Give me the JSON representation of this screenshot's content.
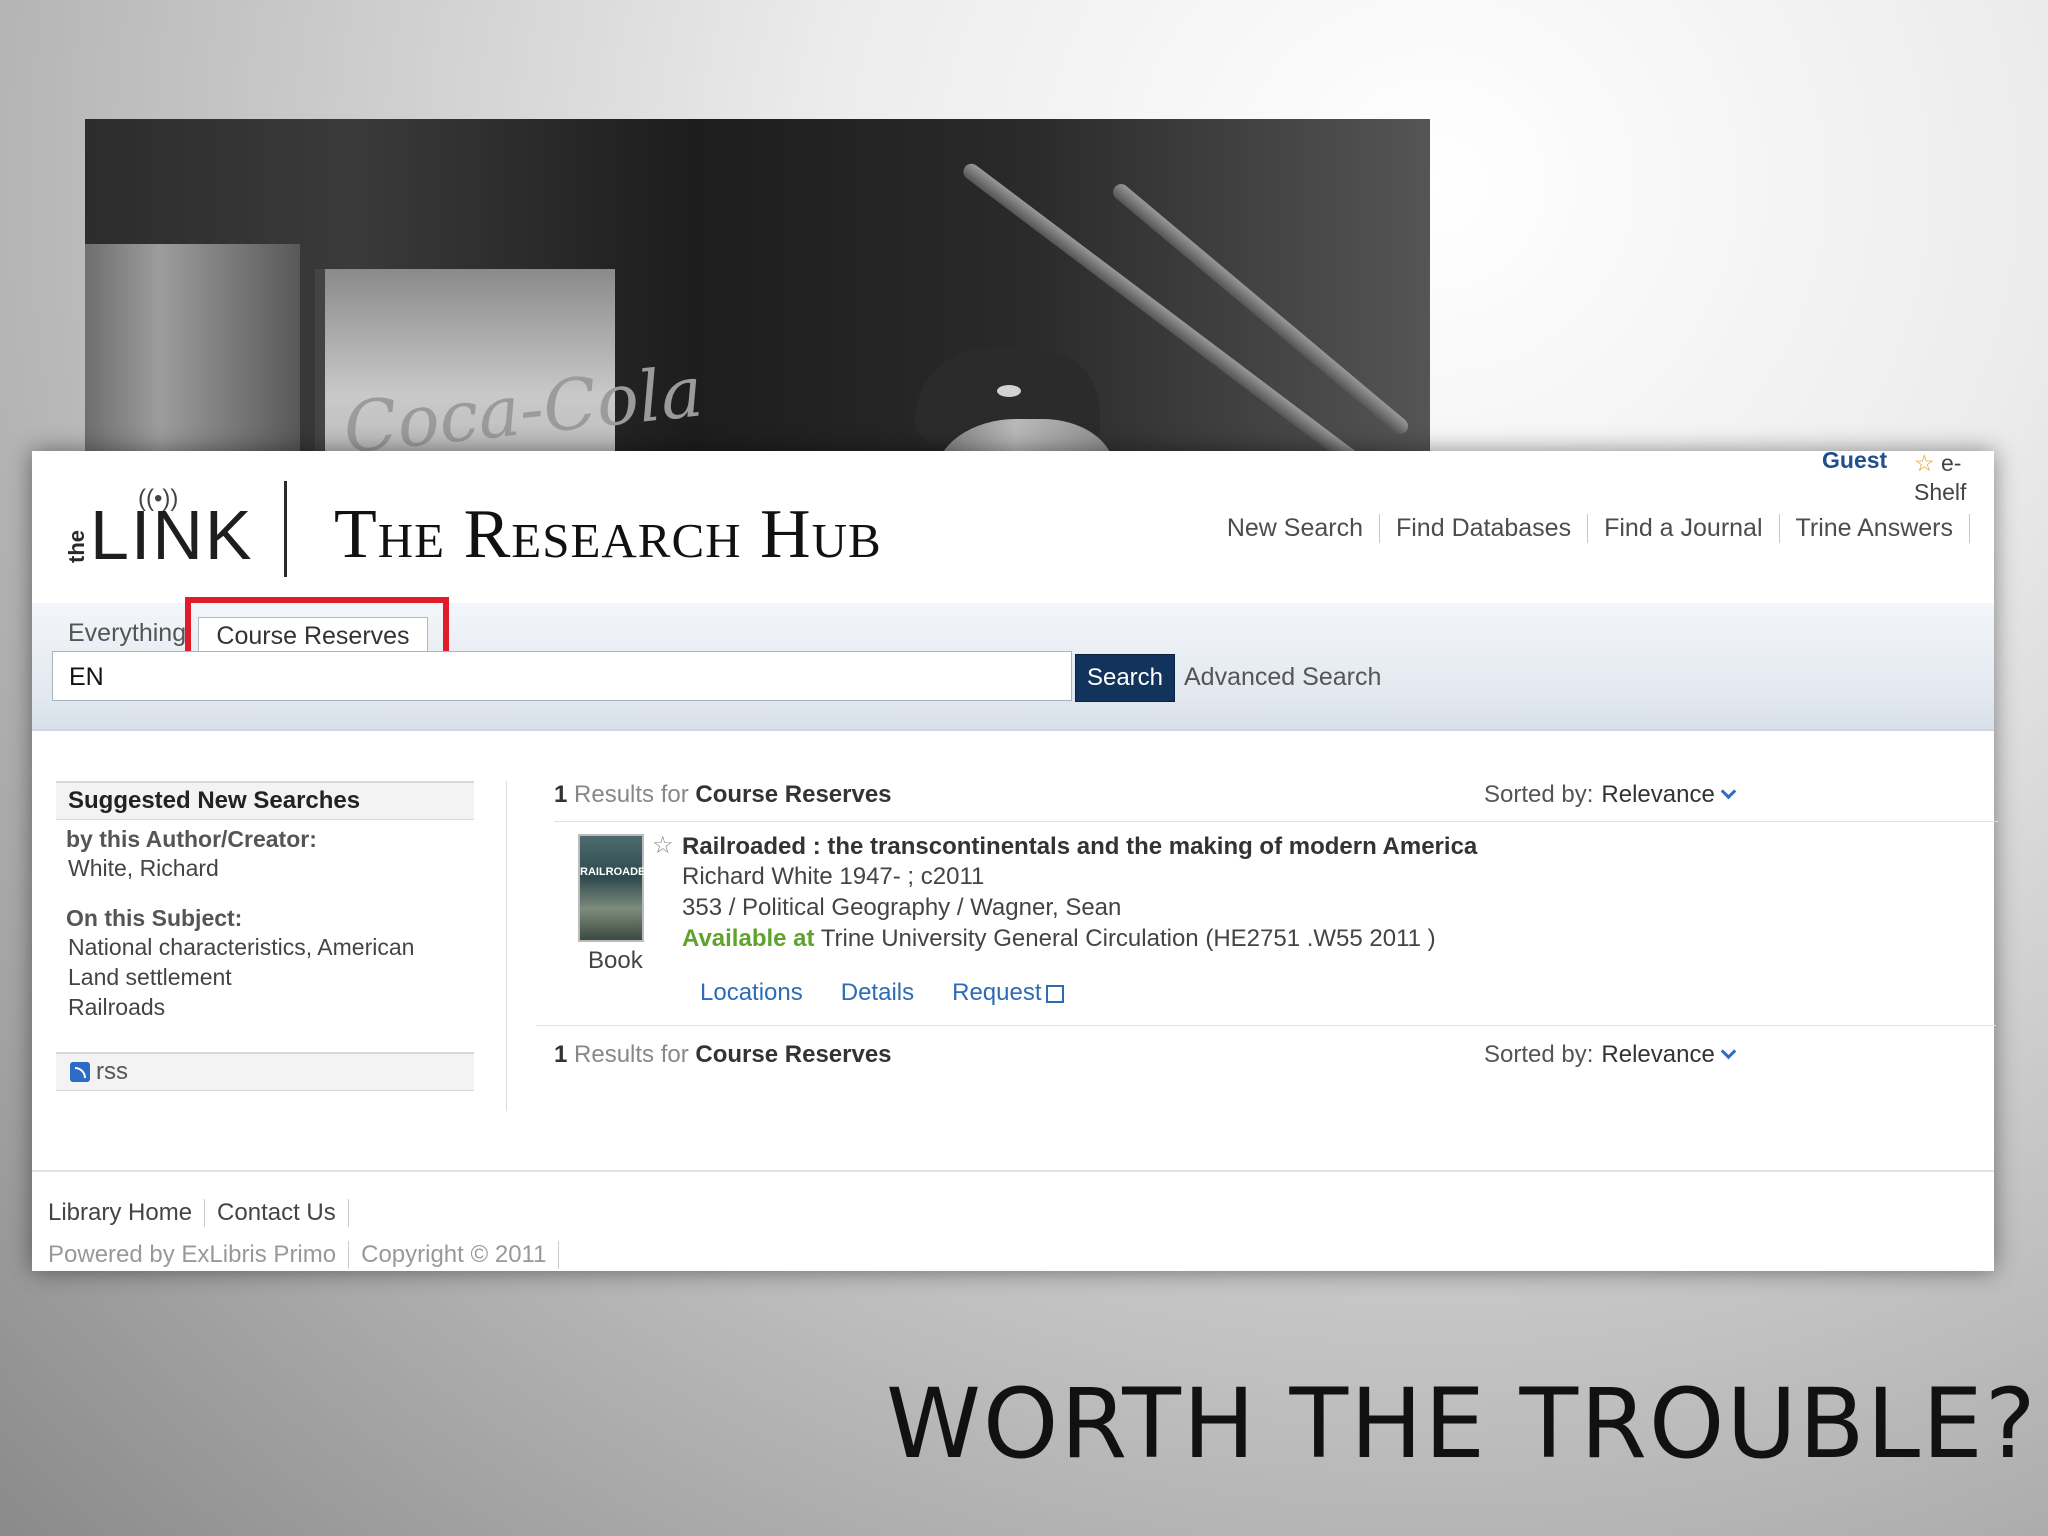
{
  "header": {
    "guest": "Guest",
    "eshelf": "e-Shelf",
    "brand_the": "the",
    "brand_link": "LINK",
    "title": "The Research Hub",
    "nav": [
      "New Search",
      "Find Databases",
      "Find a Journal",
      "Trine Answers"
    ]
  },
  "search": {
    "tabs": [
      "Everything",
      "Course Reserves"
    ],
    "query": "EN",
    "button": "Search",
    "advanced": "Advanced Search"
  },
  "sidebar": {
    "heading": "Suggested New Searches",
    "author_label": "by this Author/Creator:",
    "author": "White, Richard",
    "subject_label": "On this Subject:",
    "subjects": [
      "National characteristics, American",
      "Land settlement",
      "Railroads"
    ],
    "rss": "rss"
  },
  "results": {
    "count": "1",
    "results_for": "Results for",
    "scope": "Course Reserves",
    "sorted_by": "Sorted by:",
    "sort_value": "Relevance",
    "item": {
      "cover_text": "RAILROADED",
      "type": "Book",
      "title": "Railroaded : the transcontinentals and the making of modern America",
      "author": "Richard White 1947- ; c2011",
      "course": "353 / Political Geography / Wagner, Sean",
      "available_label": "Available at",
      "location": "Trine University General Circulation (HE2751 .W55 2011 )",
      "links": [
        "Locations",
        "Details",
        "Request"
      ]
    }
  },
  "footer": {
    "row1": [
      "Library Home",
      "Contact Us"
    ],
    "row2": [
      "Powered by ExLibris Primo",
      "Copyright © 2011"
    ]
  },
  "slide": {
    "title": "WORTH THE TROUBLE?",
    "photo_sign": "Coca-Cola"
  },
  "colors": {
    "search_button": "#12335c",
    "highlight": "#e01b2a",
    "available": "#5fa32d",
    "link": "#2c6cb4"
  }
}
